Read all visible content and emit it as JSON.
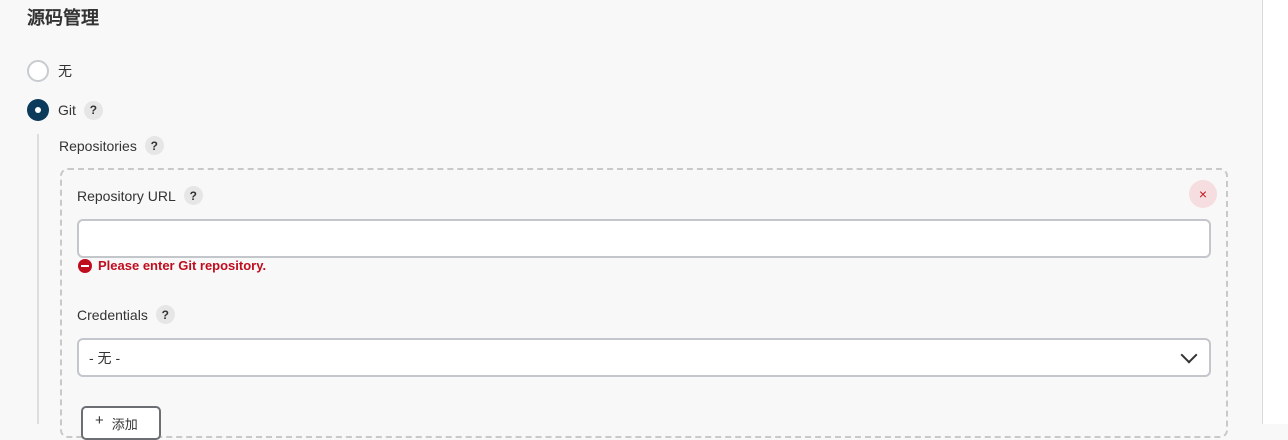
{
  "section": {
    "title": "源码管理"
  },
  "scm_options": [
    {
      "label": "无",
      "checked": false
    },
    {
      "label": "Git",
      "checked": true
    }
  ],
  "help_symbol": "?",
  "git": {
    "repositories_label": "Repositories",
    "repository": {
      "url_label": "Repository URL",
      "url_value": "",
      "url_error": "Please enter Git repository.",
      "delete_symbol": "×",
      "credentials_label": "Credentials",
      "credentials_selected": "- 无 -",
      "add_button": {
        "icon": "+",
        "label": "添加"
      }
    }
  },
  "colors": {
    "accent": "#0b3a5b",
    "error": "#c00d1e",
    "delete_bg": "#f6dde0"
  }
}
